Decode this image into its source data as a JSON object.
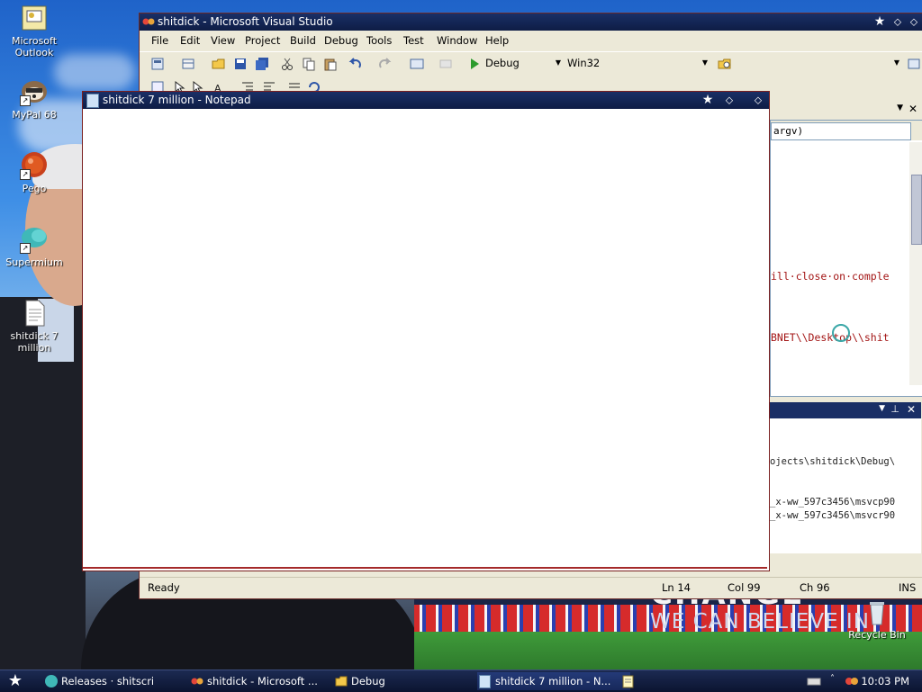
{
  "desktop": {
    "icons": [
      {
        "label": "Microsoft Outlook",
        "icon": "outlook-icon"
      },
      {
        "label": "MyPal 68",
        "icon": "raccoon-browser-icon"
      },
      {
        "label": "Pego",
        "icon": "red-ball-icon"
      },
      {
        "label": "Supermium",
        "icon": "teal-browser-icon"
      },
      {
        "label": "shitdick 7 million",
        "icon": "text-document-icon"
      }
    ],
    "recycle_bin": "Recycle Bin",
    "wallpaper": {
      "slogan_top": "CHANGE",
      "slogan_bottom": "WE CAN BELIEVE IN"
    }
  },
  "visual_studio": {
    "title": "shitdick - Microsoft Visual Studio",
    "menu": [
      "File",
      "Edit",
      "View",
      "Project",
      "Build",
      "Debug",
      "Tools",
      "Test",
      "Window",
      "Help"
    ],
    "toolbar": {
      "config": "Debug",
      "platform": "Win32",
      "start_label": "Start debugging"
    },
    "editor": {
      "scope_field": "argv)",
      "code_lines": [
        "ill·close·on·comple",
        "BNET\\\\Desktop\\\\shit"
      ]
    },
    "output": {
      "lines": [
        "ojects\\shitdick\\Debug\\",
        "_x-ww_597c3456\\msvcp90",
        "_x-ww_597c3456\\msvcr90"
      ]
    },
    "status": {
      "text": "Ready",
      "ln": "Ln 14",
      "col": "Col 99",
      "ch": "Ch 96",
      "mode": "INS"
    }
  },
  "notepad": {
    "title": "shitdick 7 million - Notepad",
    "content": ""
  },
  "taskbar": {
    "tasks": [
      {
        "label": "Releases · shitscri",
        "icon": "browser-icon"
      },
      {
        "label": "shitdick - Microsoft ...",
        "icon": "visual-studio-icon"
      },
      {
        "label": "Debug",
        "icon": "folder-icon"
      },
      {
        "label": "shitdick 7 million - N...",
        "icon": "notepad-icon"
      }
    ],
    "clock": "10:03 PM"
  },
  "colors": {
    "title_bar": "#1a2f66",
    "window_border": "#7a1f1f",
    "code_string": "#a31515",
    "taskbar": "#0b1430"
  }
}
